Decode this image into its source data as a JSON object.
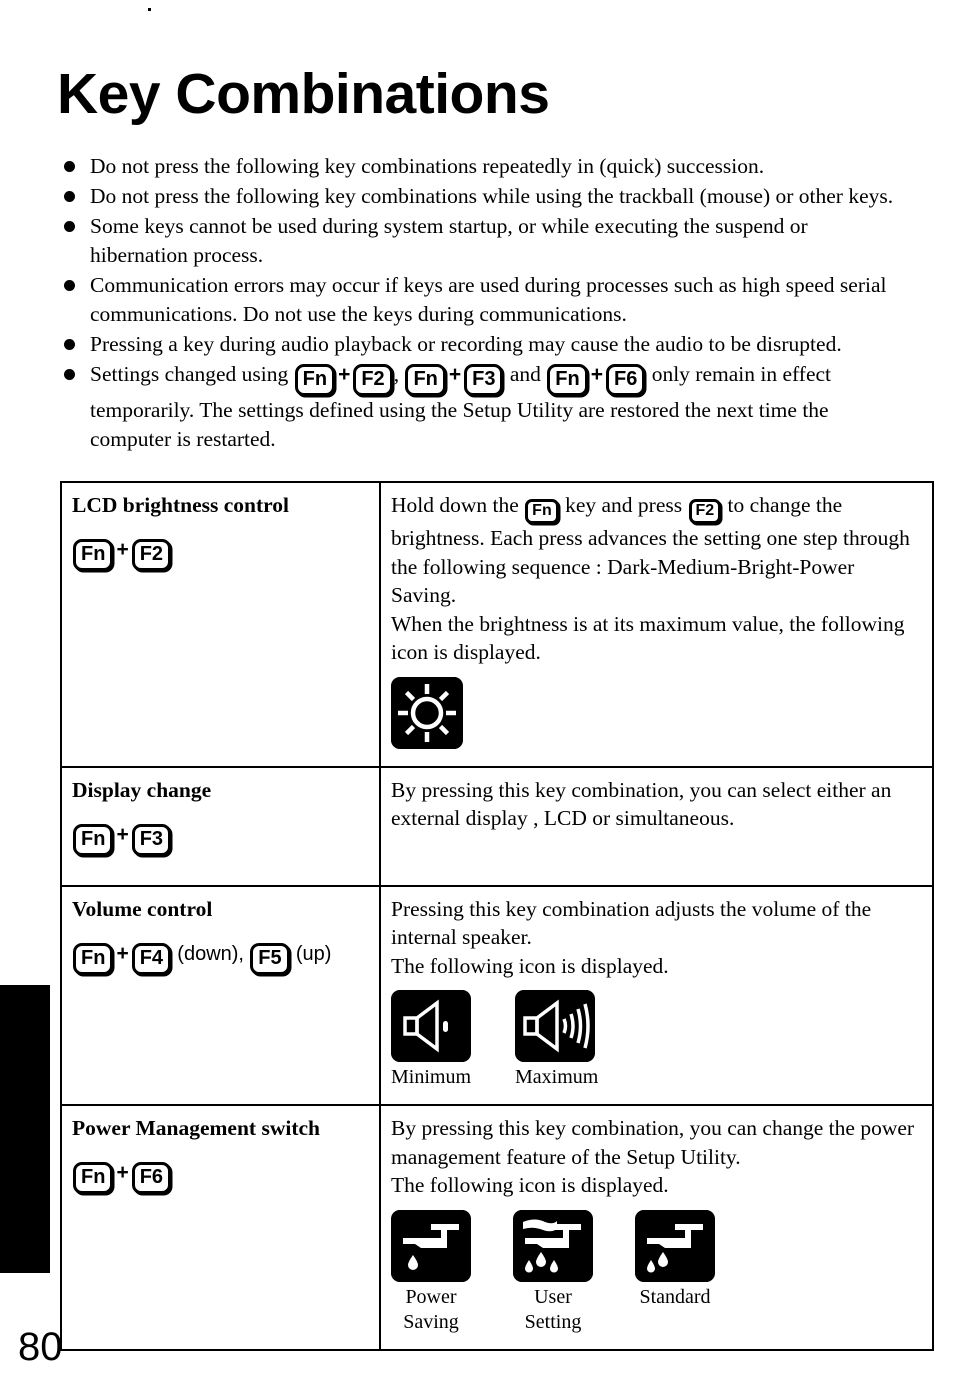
{
  "page": {
    "title": "Key Combinations",
    "number": "80"
  },
  "notes": [
    {
      "text": "Do not press the following key combinations repeatedly in (quick) succession."
    },
    {
      "text": "Do not press the following key combinations while using the trackball (mouse) or other keys."
    },
    {
      "text": "Some keys cannot be used during system startup, or while executing the suspend or hibernation process."
    },
    {
      "text": "Communication errors may occur if keys are used during processes such as high speed serial communications.  Do not use the keys during communications."
    },
    {
      "text": "Pressing a key during audio playback or recording may cause the audio to be disrupted."
    }
  ],
  "note_keys": {
    "prefix": "Settings changed using ",
    "k1": "Fn",
    "k2": "F2",
    "sep1": ",",
    "k3": "Fn",
    "k4": "F3",
    "sep2": "and",
    "k5": "Fn",
    "k6": "F6",
    "suffix": "only remain in effect temporarily. The settings defined using the Setup Utility are restored the next time the computer is restarted.",
    "plus": "+"
  },
  "table": {
    "rows": [
      {
        "title": "LCD brightness control",
        "keys": {
          "first": "Fn",
          "plus": "+",
          "second": "F2"
        },
        "desc_pre": "Hold down the ",
        "desc_key1": "Fn",
        "desc_mid": " key and press ",
        "desc_key2": "F2",
        "desc_post": " to change the brightness. Each press advances the setting one step through the following sequence : Dark-Medium-Bright-Power Saving.",
        "desc_line2": "When the brightness is at its maximum value, the following icon is displayed.",
        "icons": [
          {
            "name": "brightness-max-icon",
            "caption": ""
          }
        ]
      },
      {
        "title": "Display change",
        "keys": {
          "first": "Fn",
          "plus": "+",
          "second": "F3"
        },
        "desc_post": "By pressing this key combination, you can  select either an external display , LCD or simultaneous.",
        "icons": []
      },
      {
        "title": "Volume control",
        "keys": {
          "first": "Fn",
          "plus": "+",
          "second": "F4",
          "label_down": "(down),",
          "third": "F5",
          "label_up": "(up)"
        },
        "desc_post": "Pressing this key combination adjusts the volume of the internal speaker.",
        "desc_line2": "The following icon is displayed.",
        "icons": [
          {
            "name": "volume-minimum-icon",
            "caption": "Minimum"
          },
          {
            "name": "volume-maximum-icon",
            "caption": "Maximum"
          }
        ]
      },
      {
        "title": "Power Management switch",
        "keys": {
          "first": "Fn",
          "plus": "+",
          "second": "F6"
        },
        "desc_post": "By pressing this key combination, you can change the power management feature of the Setup Utility.",
        "desc_line2": "The following icon is displayed.",
        "icons": [
          {
            "name": "power-saving-icon",
            "caption": "Power\nSaving"
          },
          {
            "name": "user-setting-icon",
            "caption": "User\nSetting"
          },
          {
            "name": "standard-icon",
            "caption": "Standard"
          }
        ]
      }
    ]
  },
  "colors": {
    "ink": "#000000",
    "paper": "#ffffff"
  }
}
